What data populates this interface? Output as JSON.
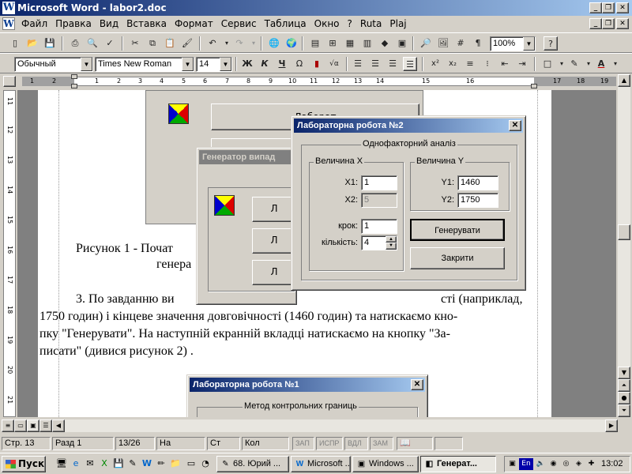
{
  "window": {
    "title": "Microsoft Word - labor2.doc",
    "app_icon": "W",
    "controls": [
      "_",
      "❐",
      "✕"
    ]
  },
  "doc_controls": [
    "_",
    "❐",
    "✕"
  ],
  "menu": {
    "icon": "W",
    "items": [
      "Файл",
      "Правка",
      "Вид",
      "Вставка",
      "Формат",
      "Сервис",
      "Таблица",
      "Окно",
      "?",
      "Ruta",
      "Plaj"
    ]
  },
  "standard_toolbar": {
    "zoom": "100%",
    "help_icon": "?"
  },
  "format_toolbar": {
    "style": "Обычный",
    "font": "Times New Roman",
    "size": "14",
    "bold": "Ж",
    "italic": "К",
    "underline": "Ч",
    "omega": "Ω",
    "sqrt": "√α",
    "sup": "x²",
    "sub": "x₂"
  },
  "ruler": {
    "numbers": [
      "1",
      "2",
      "1",
      "2",
      "3",
      "4",
      "5",
      "6",
      "7",
      "8",
      "9",
      "10",
      "11",
      "12",
      "13",
      "14",
      "15",
      "16",
      "17",
      "18",
      "19"
    ]
  },
  "vruler": {
    "numbers": [
      "11",
      "12",
      "13",
      "14",
      "15",
      "16",
      "17",
      "18",
      "19",
      "20",
      "21"
    ]
  },
  "document": {
    "caption_line1": "Рисунок 1 - Почат",
    "caption_line2": "генера",
    "para_line1_start": "3. По завданню ви",
    "para_line1_end": "сті (наприклад,",
    "para_line2": "1750 годин) і кінцеве значення довговічності (1460 годин) та натискаємо кно-",
    "para_line3": "пку \"Генерувати\". На наступній екранній вкладці натискаємо на кнопку \"За-",
    "para_line4": "писати\" (дивися рисунок 2)    ."
  },
  "embed_top": {
    "button1": "Лаборат",
    "button2": ""
  },
  "generator_window": {
    "title": "Генератор випад",
    "b1": "Л",
    "b2": "Л",
    "b3": "Л"
  },
  "lab2_dialog": {
    "title": "Лабораторна робота №2",
    "close": "✕",
    "outer_group": "Однофакторний аналіз",
    "group_x": "Величина X",
    "group_y": "Величина Y",
    "x1_label": "X1:",
    "x1_value": "1",
    "x2_label": "X2:",
    "x2_value": "5",
    "step_label": "крок:",
    "step_value": "1",
    "count_label": "кількість:",
    "count_value": "4",
    "y1_label": "Y1:",
    "y1_value": "1460",
    "y2_label": "Y2:",
    "y2_value": "1750",
    "generate_button": "Генерувати",
    "close_button": "Закрити"
  },
  "lab1_dialog": {
    "title": "Лабораторна робота №1",
    "close": "✕",
    "group": "Метод контрольних границь"
  },
  "status_bar": {
    "page": "Стр.  13",
    "section": "Разд  1",
    "pages": "13/26",
    "at": "На",
    "line": "Ст",
    "col": "Кол",
    "rec": "ЗАП",
    "trk": "ИСПР",
    "ext": "ВДЛ",
    "ovr": "ЗАМ"
  },
  "taskbar": {
    "start": "Пуск",
    "tasks": [
      {
        "label": "68. Юрий ...",
        "icon": "✎"
      },
      {
        "label": "Microsoft ...",
        "icon": "W"
      },
      {
        "label": "Windows ...",
        "icon": "▣"
      },
      {
        "label": "Генерат...",
        "icon": "◧"
      }
    ],
    "lang": "En",
    "clock": "13:02"
  },
  "colors": {
    "title_active": "#0a246a",
    "title_inactive": "#808080",
    "face": "#d4d0c8"
  }
}
